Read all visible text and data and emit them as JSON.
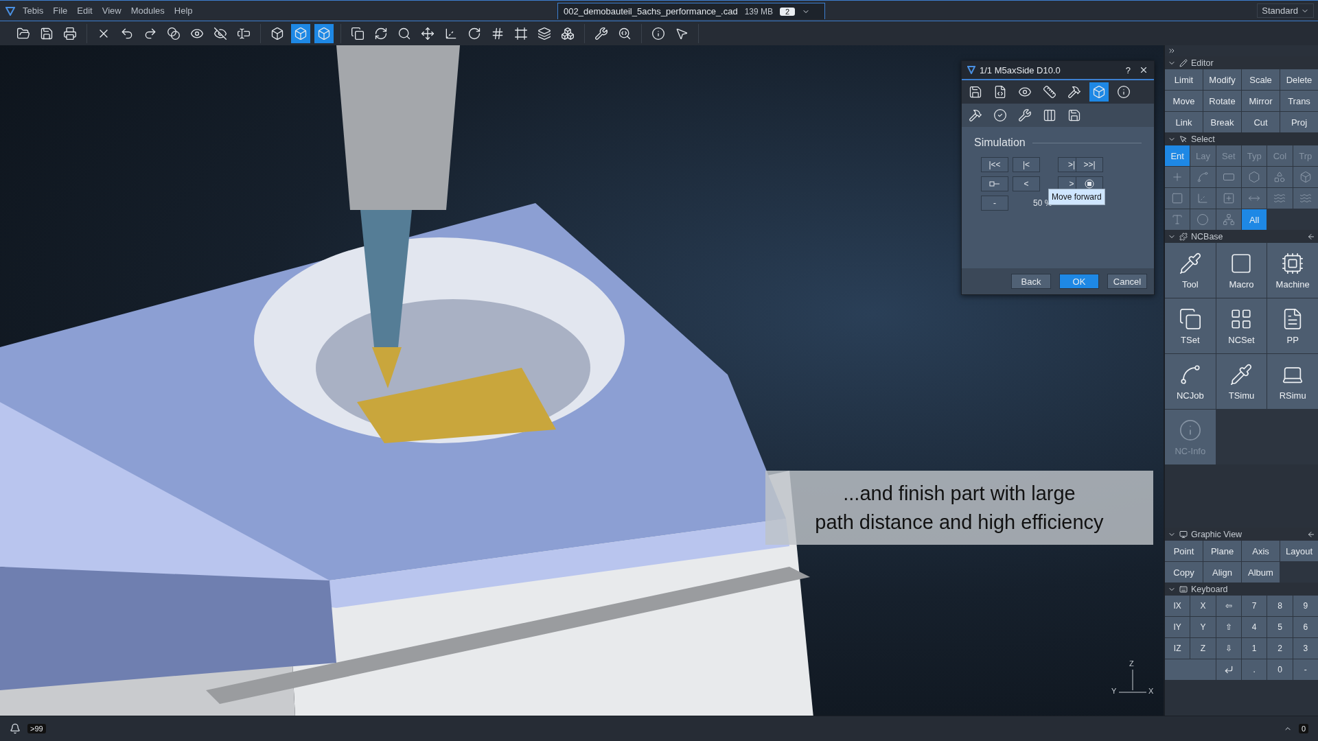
{
  "menu": [
    "Tebis",
    "File",
    "Edit",
    "View",
    "Modules",
    "Help"
  ],
  "document_tab": {
    "title": "002_demobauteil_5achs_performance_.cad",
    "size": "139 MB",
    "count": "2"
  },
  "workspace": {
    "value": "Standard"
  },
  "toolbar": [
    {
      "tools": [
        {
          "selected": false
        },
        {
          "selected": false
        },
        {
          "selected": false
        }
      ]
    },
    {
      "tools": [
        {
          "selected": false
        },
        {
          "selected": false
        },
        {
          "selected": false
        },
        {
          "selected": false
        },
        {
          "selected": false
        },
        {
          "selected": false
        },
        {
          "selected": false
        }
      ]
    },
    {
      "tools": [
        {
          "selected": false
        },
        {
          "selected": true
        },
        {
          "selected": true
        }
      ]
    },
    {
      "tools": [
        {
          "selected": false
        },
        {
          "selected": false
        },
        {
          "selected": false
        },
        {
          "selected": false
        },
        {
          "selected": false
        },
        {
          "selected": false
        },
        {
          "selected": false
        },
        {
          "selected": false
        },
        {
          "selected": false
        },
        {
          "selected": false
        }
      ]
    },
    {
      "tools": [
        {
          "selected": false
        },
        {
          "selected": false
        }
      ]
    },
    {
      "tools": [
        {
          "selected": false
        },
        {
          "selected": false
        }
      ]
    }
  ],
  "viewport": {
    "caption": "...and finish part with large\npath distance and high efficiency",
    "triad_labels": [
      "Z",
      "Y",
      "X"
    ]
  },
  "dialog": {
    "title": "1/1 M5axSide D10.0",
    "help": "?",
    "tools_row_1": [
      {
        "selected": false
      },
      {
        "selected": false
      },
      {
        "selected": false
      },
      {
        "selected": false
      },
      {
        "selected": false
      },
      {
        "selected": true
      },
      {
        "selected": false
      }
    ],
    "tools_row_2": [
      {
        "selected": false
      },
      {
        "selected": false
      },
      {
        "selected": false
      },
      {
        "selected": false
      },
      {
        "selected": false
      }
    ],
    "section": "Simulation",
    "sim_buttons": [
      {
        "kind": "text",
        "label": "|<<"
      },
      {
        "kind": "text",
        "label": "|<"
      },
      {
        "kind": "text",
        "label": ">|"
      },
      {
        "kind": "text",
        "label": ">>|"
      },
      {
        "kind": "slider"
      },
      {
        "kind": "text",
        "label": "<"
      },
      {
        "kind": "text",
        "label": ">"
      },
      {
        "kind": "stop"
      }
    ],
    "speed_button": "-",
    "speed": "50 %",
    "tooltip": "Move forward",
    "buttons": [
      {
        "label": "Back",
        "primary": false
      },
      {
        "label": "OK",
        "primary": true
      },
      {
        "label": "Cancel",
        "primary": false
      }
    ]
  },
  "panel": {
    "editor": {
      "title": "Editor",
      "buttons": [
        "Limit",
        "Modify",
        "Scale",
        "Delete",
        "Move",
        "Rotate",
        "Mirror",
        "Trans",
        "Link",
        "Break",
        "Cut",
        "Proj"
      ]
    },
    "select": {
      "title": "Select",
      "tabs": [
        {
          "label": "Ent",
          "selected": true,
          "disabled": false
        },
        {
          "label": "Lay",
          "selected": false,
          "disabled": true
        },
        {
          "label": "Set",
          "selected": false,
          "disabled": true
        },
        {
          "label": "Typ",
          "selected": false,
          "disabled": true
        },
        {
          "label": "Col",
          "selected": false,
          "disabled": true
        },
        {
          "label": "Trp",
          "selected": false,
          "disabled": true
        }
      ],
      "all": {
        "label": "All",
        "selected": true
      }
    },
    "ncbase": {
      "title": "NCBase",
      "items": [
        {
          "label": "Tool",
          "disabled": false
        },
        {
          "label": "Macro",
          "disabled": false
        },
        {
          "label": "Machine",
          "disabled": false
        },
        {
          "label": "TSet",
          "disabled": false
        },
        {
          "label": "NCSet",
          "disabled": false
        },
        {
          "label": "PP",
          "disabled": false
        },
        {
          "label": "NCJob",
          "disabled": false
        },
        {
          "label": "TSimu",
          "disabled": false
        },
        {
          "label": "RSimu",
          "disabled": false
        },
        {
          "label": "NC-Info",
          "disabled": true
        }
      ]
    },
    "graphic_view": {
      "title": "Graphic View",
      "buttons": [
        "Point",
        "Plane",
        "Axis",
        "Layout",
        "Copy",
        "Align",
        "Album"
      ]
    },
    "keyboard": {
      "title": "Keyboard",
      "keys": [
        {
          "kind": "text",
          "label": "IX"
        },
        {
          "kind": "text",
          "label": "X"
        },
        {
          "kind": "text",
          "label": "⇦"
        },
        {
          "kind": "text",
          "label": "7"
        },
        {
          "kind": "text",
          "label": "8"
        },
        {
          "kind": "text",
          "label": "9"
        },
        {
          "kind": "text",
          "label": "IY"
        },
        {
          "kind": "text",
          "label": "Y"
        },
        {
          "kind": "text",
          "label": "⇧"
        },
        {
          "kind": "text",
          "label": "4"
        },
        {
          "kind": "text",
          "label": "5"
        },
        {
          "kind": "text",
          "label": "6"
        },
        {
          "kind": "text",
          "label": "IZ"
        },
        {
          "kind": "text",
          "label": "Z"
        },
        {
          "kind": "text",
          "label": "⇩"
        },
        {
          "kind": "text",
          "label": "1"
        },
        {
          "kind": "text",
          "label": "2"
        },
        {
          "kind": "text",
          "label": "3"
        },
        {
          "kind": "blank"
        },
        {
          "kind": "enter"
        },
        {
          "kind": "text",
          "label": "."
        },
        {
          "kind": "text",
          "label": "0"
        },
        {
          "kind": "text",
          "label": "-"
        }
      ]
    }
  },
  "status_bar": {
    "notifications": ">99",
    "counter": "0"
  }
}
